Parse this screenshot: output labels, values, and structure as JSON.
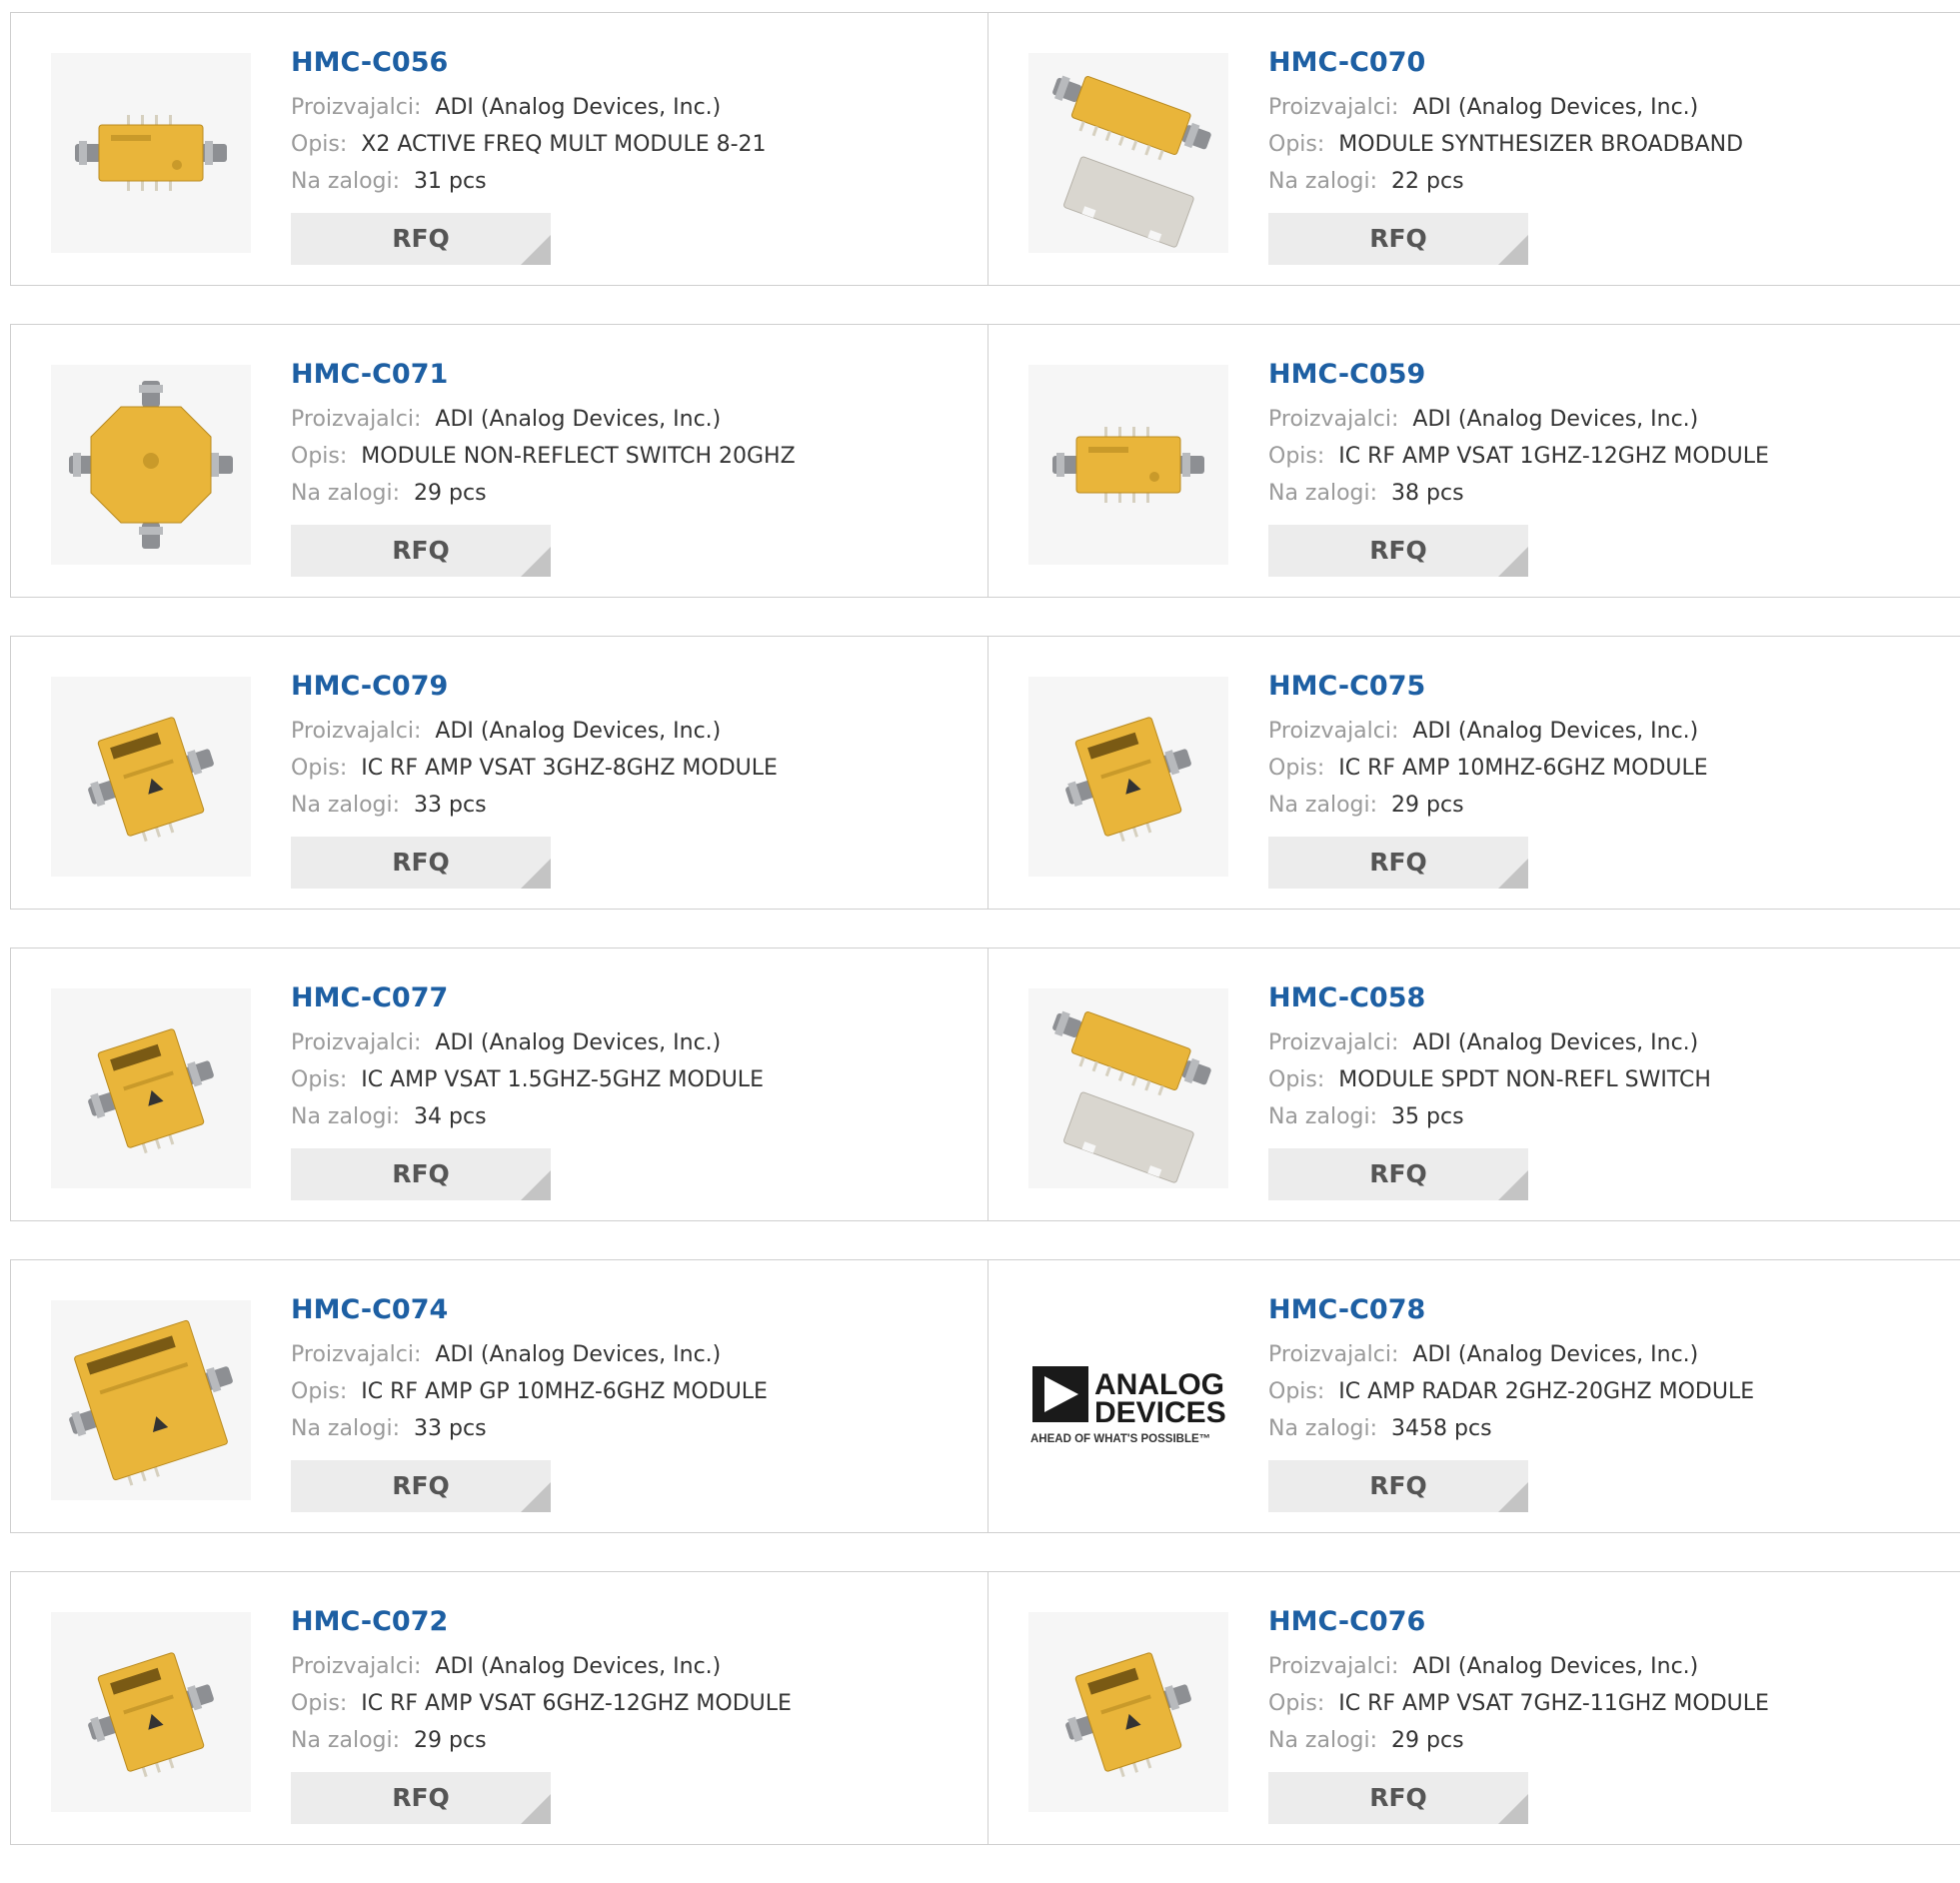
{
  "labels": {
    "manufacturer": "Proizvajalci:",
    "description": "Opis:",
    "stock": "Na zalogi:",
    "rfq": "RFQ"
  },
  "products": [
    {
      "pn": "HMC-C056",
      "manufacturer": "ADI (Analog Devices, Inc.)",
      "description": "X2 ACTIVE FREQ MULT MODULE 8-21",
      "stock": "31 pcs",
      "image": "gold-module-horizontal"
    },
    {
      "pn": "HMC-C070",
      "manufacturer": "ADI (Analog Devices, Inc.)",
      "description": "MODULE SYNTHESIZER BROADBAND",
      "stock": "22 pcs",
      "image": "gold-module-with-lid"
    },
    {
      "pn": "HMC-C071",
      "manufacturer": "ADI (Analog Devices, Inc.)",
      "description": "MODULE NON-REFLECT SWITCH 20GHZ",
      "stock": "29 pcs",
      "image": "gold-octagon-switch"
    },
    {
      "pn": "HMC-C059",
      "manufacturer": "ADI (Analog Devices, Inc.)",
      "description": "IC RF AMP VSAT 1GHZ-12GHZ MODULE",
      "stock": "38 pcs",
      "image": "gold-module-horizontal"
    },
    {
      "pn": "HMC-C079",
      "manufacturer": "ADI (Analog Devices, Inc.)",
      "description": "IC RF AMP VSAT 3GHZ-8GHZ MODULE",
      "stock": "33 pcs",
      "image": "gold-module-tilted"
    },
    {
      "pn": "HMC-C075",
      "manufacturer": "ADI (Analog Devices, Inc.)",
      "description": "IC RF AMP 10MHZ-6GHZ MODULE",
      "stock": "29 pcs",
      "image": "gold-module-tilted"
    },
    {
      "pn": "HMC-C077",
      "manufacturer": "ADI (Analog Devices, Inc.)",
      "description": "IC AMP VSAT 1.5GHZ-5GHZ MODULE",
      "stock": "34 pcs",
      "image": "gold-module-tilted"
    },
    {
      "pn": "HMC-C058",
      "manufacturer": "ADI (Analog Devices, Inc.)",
      "description": "MODULE SPDT NON-REFL SWITCH",
      "stock": "35 pcs",
      "image": "gold-module-with-lid"
    },
    {
      "pn": "HMC-C074",
      "manufacturer": "ADI (Analog Devices, Inc.)",
      "description": "IC RF AMP GP 10MHZ-6GHZ MODULE",
      "stock": "33 pcs",
      "image": "gold-module-tilted-large"
    },
    {
      "pn": "HMC-C078",
      "manufacturer": "ADI (Analog Devices, Inc.)",
      "description": "IC AMP RADAR 2GHZ-20GHZ MODULE",
      "stock": "3458 pcs",
      "image": "analog-devices-logo"
    },
    {
      "pn": "HMC-C072",
      "manufacturer": "ADI (Analog Devices, Inc.)",
      "description": "IC RF AMP VSAT 6GHZ-12GHZ MODULE",
      "stock": "29 pcs",
      "image": "gold-module-tilted"
    },
    {
      "pn": "HMC-C076",
      "manufacturer": "ADI (Analog Devices, Inc.)",
      "description": "IC RF AMP VSAT 7GHZ-11GHZ MODULE",
      "stock": "29 pcs",
      "image": "gold-module-tilted"
    }
  ],
  "logo": {
    "line1": "ANALOG",
    "line2": "DEVICES",
    "tagline": "AHEAD OF WHAT'S POSSIBLE™"
  },
  "colors": {
    "link": "#1d5fa3",
    "label": "#9a9a9a",
    "value": "#333333",
    "button_bg": "#ececec",
    "module_gold": "#e9b53a"
  }
}
